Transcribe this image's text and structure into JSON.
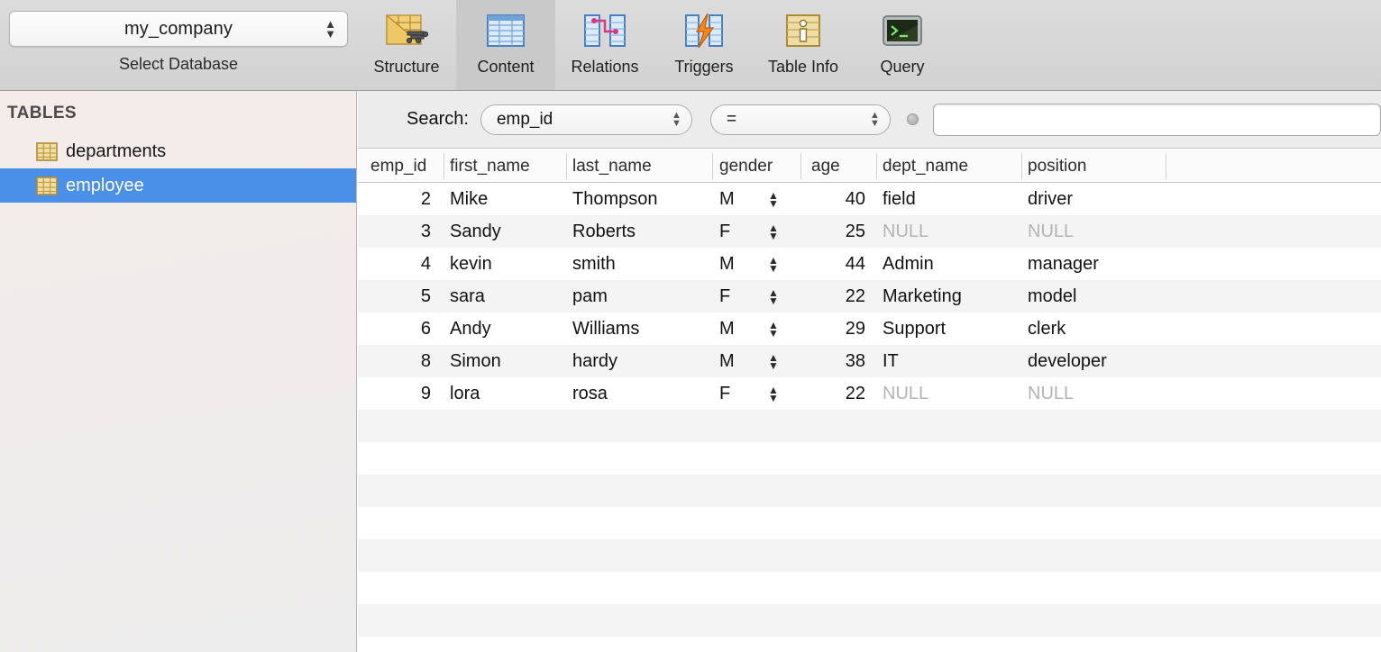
{
  "toolbar": {
    "database": {
      "value": "my_company",
      "caption": "Select Database"
    },
    "items": [
      {
        "label": "Structure",
        "icon": "table-structure-icon",
        "active": false
      },
      {
        "label": "Content",
        "icon": "table-content-icon",
        "active": true
      },
      {
        "label": "Relations",
        "icon": "relations-icon",
        "active": false
      },
      {
        "label": "Triggers",
        "icon": "triggers-icon",
        "active": false
      },
      {
        "label": "Table Info",
        "icon": "table-info-icon",
        "active": false
      },
      {
        "label": "Query",
        "icon": "query-terminal-icon",
        "active": false
      }
    ]
  },
  "sidebar": {
    "header": "TABLES",
    "tables": [
      {
        "name": "departments",
        "selected": false
      },
      {
        "name": "employee",
        "selected": true
      }
    ]
  },
  "search": {
    "label": "Search:",
    "field": "emp_id",
    "operator": "=",
    "value": "",
    "placeholder": ""
  },
  "grid": {
    "columns": [
      "emp_id",
      "first_name",
      "last_name",
      "gender",
      "age",
      "dept_name",
      "position"
    ],
    "rows": [
      {
        "emp_id": "2",
        "first_name": "Mike",
        "last_name": "Thompson",
        "gender": "M",
        "age": "40",
        "dept_name": "field",
        "position": "driver"
      },
      {
        "emp_id": "3",
        "first_name": "Sandy",
        "last_name": "Roberts",
        "gender": "F",
        "age": "25",
        "dept_name": "NULL",
        "position": "NULL"
      },
      {
        "emp_id": "4",
        "first_name": "kevin",
        "last_name": "smith",
        "gender": "M",
        "age": "44",
        "dept_name": "Admin",
        "position": "manager"
      },
      {
        "emp_id": "5",
        "first_name": "sara",
        "last_name": "pam",
        "gender": "F",
        "age": "22",
        "dept_name": "Marketing",
        "position": "model"
      },
      {
        "emp_id": "6",
        "first_name": "Andy",
        "last_name": "Williams",
        "gender": "M",
        "age": "29",
        "dept_name": "Support",
        "position": "clerk"
      },
      {
        "emp_id": "8",
        "first_name": "Simon",
        "last_name": "hardy",
        "gender": "M",
        "age": "38",
        "dept_name": "IT",
        "position": "developer"
      },
      {
        "emp_id": "9",
        "first_name": "lora",
        "last_name": "rosa",
        "gender": "F",
        "age": "22",
        "dept_name": "NULL",
        "position": "NULL"
      }
    ],
    "empty_row_count": 7
  },
  "colors": {
    "selection": "#4a90e8",
    "toolbar_bg": "#d6d6d6",
    "active_tool_bg": "#c9c9c9",
    "stripe": "#f4f4f4",
    "null_text": "#b4b4b4"
  }
}
